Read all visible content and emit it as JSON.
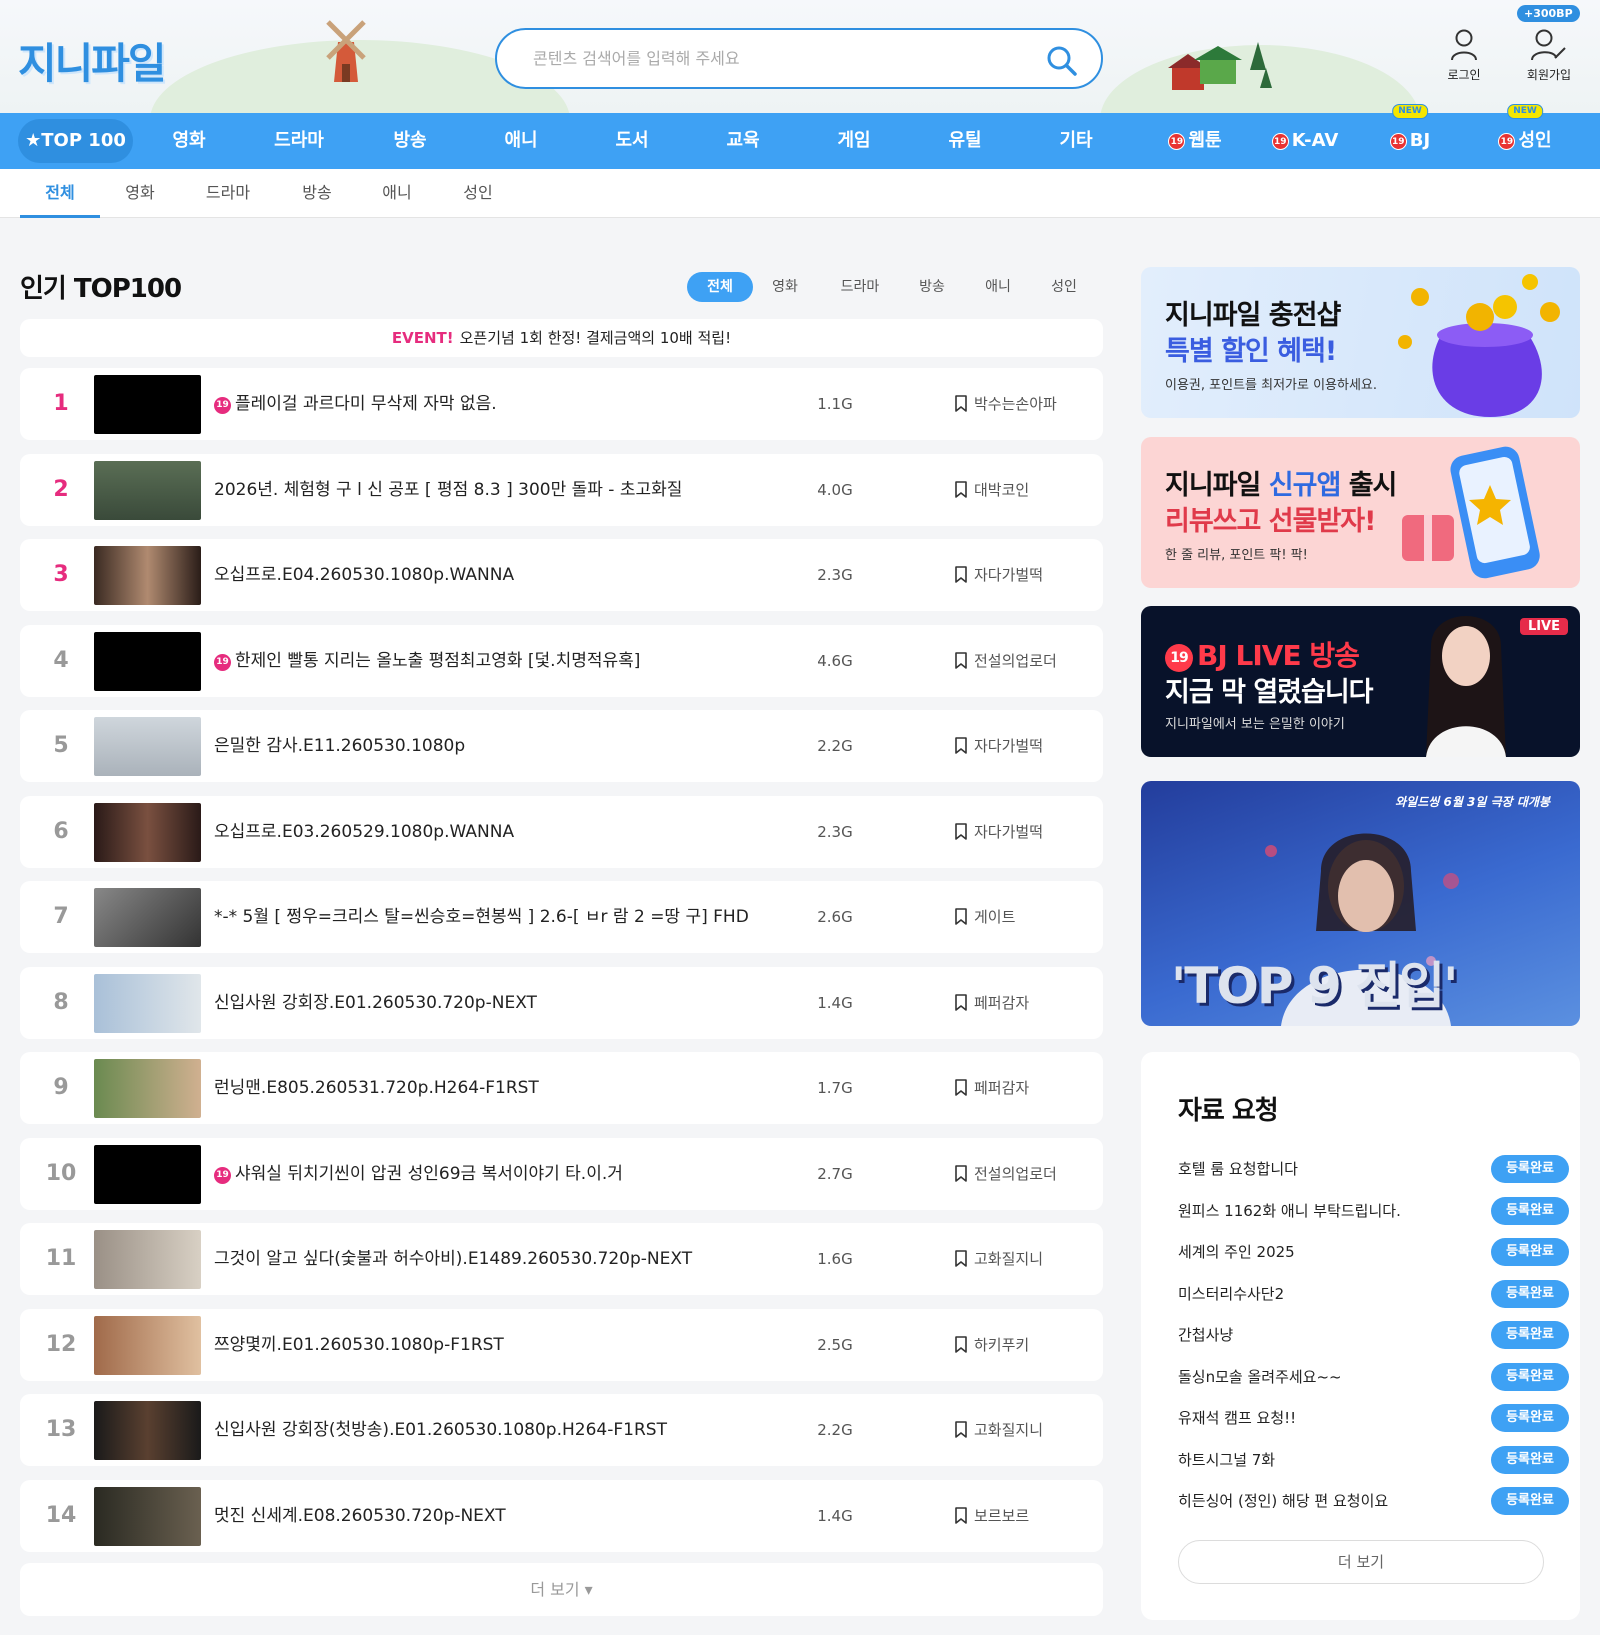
{
  "header": {
    "logo": "지니파일",
    "search_placeholder": "콘텐츠 검색어를 입력해 주세요",
    "login_label": "로그인",
    "signup_label": "회원가입",
    "signup_bonus": "+300BP"
  },
  "nav": {
    "top100": "TOP 100",
    "items": [
      "영화",
      "드라마",
      "방송",
      "애니",
      "도서",
      "교육",
      "게임",
      "유틸",
      "기타"
    ],
    "adult_items": [
      "웹툰",
      "K-AV",
      "BJ",
      "성인"
    ],
    "adult_badge": "19",
    "new_badge": "NEW"
  },
  "subtabs": [
    "전체",
    "영화",
    "드라마",
    "방송",
    "애니",
    "성인"
  ],
  "main": {
    "title": "인기 TOP100",
    "filters": [
      "전체",
      "영화",
      "드라마",
      "방송",
      "애니",
      "성인"
    ],
    "event_tag": "EVENT!",
    "event_text": "오픈기념 1회 한정! 결제금액의 10배 적립!",
    "more_label": "더 보기 ▾",
    "rows": [
      {
        "rank": "1",
        "title": "플레이걸 과르다미 무삭제 자막 없음.",
        "size": "1.1G",
        "uploader": "박수는손아파",
        "adult": "19"
      },
      {
        "rank": "2",
        "title": "2026년. 체험형 구 l 신 공포 [ 평점 8.3 ] 300만 돌파 - 초고화질",
        "size": "4.0G",
        "uploader": "대박코인",
        "adult": ""
      },
      {
        "rank": "3",
        "title": "오십프로.E04.260530.1080p.WANNA",
        "size": "2.3G",
        "uploader": "자다가벌떡",
        "adult": ""
      },
      {
        "rank": "4",
        "title": "한제인 빨통 지리는 올노출 평점최고영화 [덫.치명적유혹]",
        "size": "4.6G",
        "uploader": "전설의업로더",
        "adult": "19"
      },
      {
        "rank": "5",
        "title": "은밀한 감사.E11.260530.1080p",
        "size": "2.2G",
        "uploader": "자다가벌떡",
        "adult": ""
      },
      {
        "rank": "6",
        "title": "오십프로.E03.260529.1080p.WANNA",
        "size": "2.3G",
        "uploader": "자다가벌떡",
        "adult": ""
      },
      {
        "rank": "7",
        "title": "*-* 5월 [ 쩡우=크리스 탈=씬승호=현봉씩 ] 2.6-[ ㅂr 람 2 =땅 구] FHD",
        "size": "2.6G",
        "uploader": "게이트",
        "adult": ""
      },
      {
        "rank": "8",
        "title": "신입사원 강회장.E01.260530.720p-NEXT",
        "size": "1.4G",
        "uploader": "페퍼감자",
        "adult": ""
      },
      {
        "rank": "9",
        "title": "런닝맨.E805.260531.720p.H264-F1RST",
        "size": "1.7G",
        "uploader": "페퍼감자",
        "adult": ""
      },
      {
        "rank": "10",
        "title": "샤워실 뒤치기씬이 압권 성인69금 복서이야기 타.이.거",
        "size": "2.7G",
        "uploader": "전설의업로더",
        "adult": "19"
      },
      {
        "rank": "11",
        "title": "그것이 알고 싶다(숯불과 허수아비).E1489.260530.720p-NEXT",
        "size": "1.6G",
        "uploader": "고화질지니",
        "adult": ""
      },
      {
        "rank": "12",
        "title": "쯔양몇끼.E01.260530.1080p-F1RST",
        "size": "2.5G",
        "uploader": "하키푸키",
        "adult": ""
      },
      {
        "rank": "13",
        "title": "신입사원 강회장(첫방송).E01.260530.1080p.H264-F1RST",
        "size": "2.2G",
        "uploader": "고화질지니",
        "adult": ""
      },
      {
        "rank": "14",
        "title": "멋진 신세계.E08.260530.720p-NEXT",
        "size": "1.4G",
        "uploader": "보르보르",
        "adult": ""
      }
    ]
  },
  "banners": {
    "b1_line1": "지니파일 충전샵",
    "b1_line2": "특별 할인 혜택!",
    "b1_sub": "이용권, 포인트를 최저가로 이용하세요.",
    "b2_line1a": "지니파일 ",
    "b2_line1b": "신규앱",
    "b2_line1c": " 출시",
    "b2_line2": "리뷰쓰고 선물받자!",
    "b2_sub": "한 줄 리뷰, 포인트 팍! 팍!",
    "b3_badge": "19",
    "b3_line1": "BJ LIVE 방송",
    "b3_line2": "지금 막 열렸습니다",
    "b3_sub": "지니파일에서 보는 은밀한 이야기",
    "b3_live": "LIVE",
    "b4_top": "와일드씽 6월 3일 극장 대개봉",
    "b4_title": "'TOP 9 진입'"
  },
  "requests": {
    "title": "자료 요청",
    "items": [
      {
        "label": "호텔 룸 요청합니다",
        "status": "등록완료"
      },
      {
        "label": "원피스 1162화 애니 부탁드립니다.",
        "status": "등록완료"
      },
      {
        "label": "세계의 주인 2025",
        "status": "등록완료"
      },
      {
        "label": "미스터리수사단2",
        "status": "등록완료"
      },
      {
        "label": "간첩사냥",
        "status": "등록완료"
      },
      {
        "label": "돌싱n모솔 올려주세요~~",
        "status": "등록완료"
      },
      {
        "label": "유재석 캠프 요청!!",
        "status": "등록완료"
      },
      {
        "label": "하트시그널 7화",
        "status": "등록완료"
      },
      {
        "label": "히든싱어 (정인) 해당 편 요청이요",
        "status": "등록완료"
      }
    ],
    "more_label": "더 보기"
  },
  "colors": {
    "accent": "#3ea1f4",
    "brand": "#2f8fe0",
    "pink": "#e62c7e"
  }
}
